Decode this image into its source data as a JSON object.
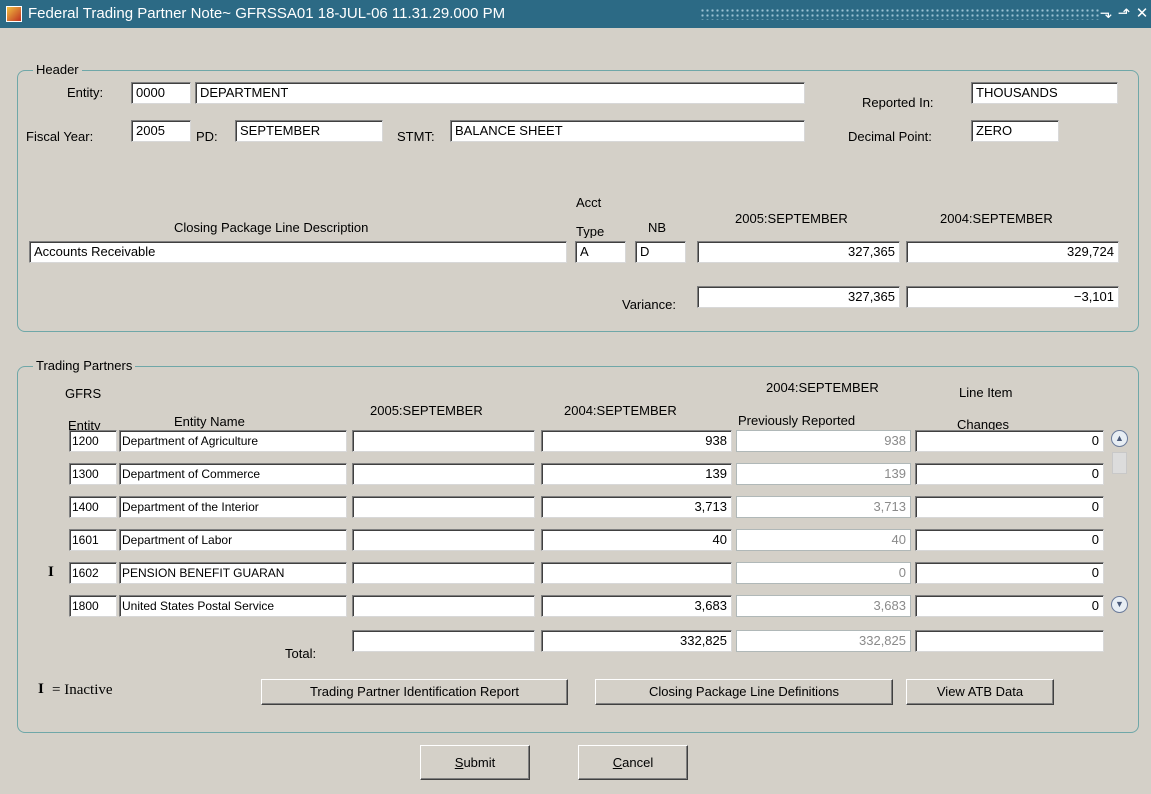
{
  "window": {
    "title": "Federal Trading Partner Note~ GFRSSA01  18-JUL-06 11.31.29.000 PM",
    "buttons": {
      "minimize": "⬎",
      "maximize": "⬏",
      "close": "✕"
    }
  },
  "header": {
    "legend": "Header",
    "entity_label": "Entity:",
    "entity_code": "0000",
    "entity_name": "DEPARTMENT",
    "reported_in_label": "Reported In:",
    "reported_in": "THOUSANDS",
    "fiscal_year_label": "Fiscal Year:",
    "fiscal_year": "2005",
    "pd_label": "PD:",
    "pd": "SEPTEMBER",
    "stmt_label": "STMT:",
    "stmt": "BALANCE SHEET",
    "decimal_point_label": "Decimal Point:",
    "decimal_point": "ZERO",
    "col_description": "Closing Package Line Description",
    "col_acct": "Acct",
    "col_type": "Type",
    "col_nb": "NB",
    "col_current": "2005:SEPTEMBER",
    "col_prior": "2004:SEPTEMBER",
    "line_description": "Accounts Receivable",
    "acct_type": "A",
    "nb": "D",
    "current_value": "327,365",
    "prior_value": "329,724",
    "variance_label": "Variance:",
    "variance_current": "327,365",
    "variance_prior": "−3,101"
  },
  "trading_partners": {
    "legend": "Trading Partners",
    "col_gfrs": "GFRS",
    "col_entity": "Entity",
    "col_entity_name": "Entity Name",
    "col_current": "2005:SEPTEMBER",
    "col_prior": "2004:SEPTEMBER",
    "col_prev_reported_top": "2004:SEPTEMBER",
    "col_prev_reported": "Previously Reported",
    "col_line_item": "Line Item",
    "col_changes": "Changes",
    "rows": [
      {
        "inactive": "",
        "entity": "1200",
        "name": "Department of Agriculture",
        "current": "",
        "prior": "938",
        "prev": "938",
        "changes": "0"
      },
      {
        "inactive": "",
        "entity": "1300",
        "name": "Department of Commerce",
        "current": "",
        "prior": "139",
        "prev": "139",
        "changes": "0"
      },
      {
        "inactive": "",
        "entity": "1400",
        "name": "Department of the Interior",
        "current": "",
        "prior": "3,713",
        "prev": "3,713",
        "changes": "0"
      },
      {
        "inactive": "",
        "entity": "1601",
        "name": "Department of Labor",
        "current": "",
        "prior": "40",
        "prev": "40",
        "changes": "0"
      },
      {
        "inactive": "I",
        "entity": "1602",
        "name": "PENSION BENEFIT GUARAN",
        "current": "",
        "prior": "",
        "prev": "0",
        "changes": "0"
      },
      {
        "inactive": "",
        "entity": "1800",
        "name": "United States Postal Service",
        "current": "",
        "prior": "3,683",
        "prev": "3,683",
        "changes": "0"
      }
    ],
    "total_label": "Total:",
    "total_current": "",
    "total_prior": "332,825",
    "total_prev": "332,825",
    "total_changes": "",
    "inactive_mark": "I",
    "inactive_legend": "= Inactive",
    "btn_tp_report": "Trading Partner Identification Report",
    "btn_line_defs": "Closing Package Line Definitions",
    "btn_atb": "View ATB Data",
    "scroll_up": "▲",
    "scroll_down": "▼"
  },
  "footer": {
    "submit_first": "S",
    "submit_rest": "ubmit",
    "cancel_first": "C",
    "cancel_rest": "ancel"
  }
}
